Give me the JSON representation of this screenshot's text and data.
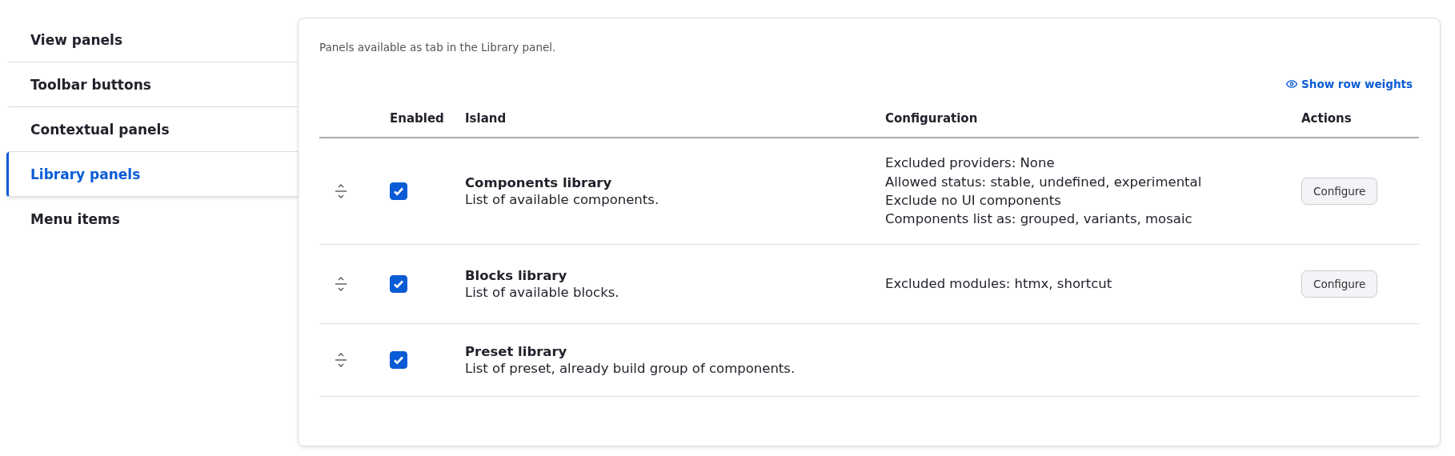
{
  "sidebar": {
    "items": [
      {
        "label": "View panels",
        "selected": false
      },
      {
        "label": "Toolbar buttons",
        "selected": false
      },
      {
        "label": "Contextual panels",
        "selected": false
      },
      {
        "label": "Library panels",
        "selected": true
      },
      {
        "label": "Menu items",
        "selected": false
      }
    ]
  },
  "panel": {
    "description": "Panels available as tab in the Library panel.",
    "weights_link": "Show row weights",
    "table": {
      "columns": [
        "Enabled",
        "Island",
        "Configuration",
        "Actions"
      ],
      "rows": [
        {
          "enabled": true,
          "title": "Components library",
          "subtitle": "List of available components.",
          "configuration": [
            "Excluded providers: None",
            "Allowed status: stable, undefined, experimental",
            "Exclude no UI components",
            "Components list as: grouped, variants, mosaic"
          ],
          "action": "Configure"
        },
        {
          "enabled": true,
          "title": "Blocks library",
          "subtitle": "List of available blocks.",
          "configuration": [
            "Excluded modules: htmx, shortcut"
          ],
          "action": "Configure"
        },
        {
          "enabled": true,
          "title": "Preset library",
          "subtitle": "List of preset, already build group of components."
        }
      ]
    }
  }
}
